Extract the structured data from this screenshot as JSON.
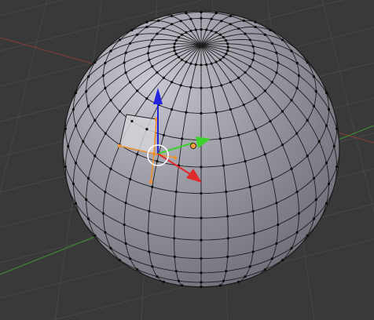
{
  "viewport": {
    "view": "3d-viewport-edit-mode",
    "object": "uv-sphere-mesh",
    "selection": "single-face",
    "colors": {
      "background": "#393939",
      "grid_line": "#474747",
      "x_axis": "#7a3a3a",
      "y_axis": "#3f8a2f",
      "mesh_face": "#9a9aa4",
      "mesh_highlight": "#c9c9d3",
      "mesh_shadow": "#6c6c76",
      "wire": "#1e1e1e",
      "vertex": "#0a0a0a",
      "selected_face": "#d2d2d8",
      "selected_edge": "#f0922c",
      "gizmo_x": "#e02b2b",
      "gizmo_y": "#3cd22b",
      "gizmo_z": "#2323e0",
      "cursor_ring": "#ffffff",
      "origin_dot": "#f0a040"
    },
    "gizmo": {
      "x_axis_icon": "arrow-x-icon",
      "y_axis_icon": "arrow-y-icon",
      "z_axis_icon": "arrow-z-icon",
      "pivot_icon": "3d-cursor-icon"
    }
  }
}
